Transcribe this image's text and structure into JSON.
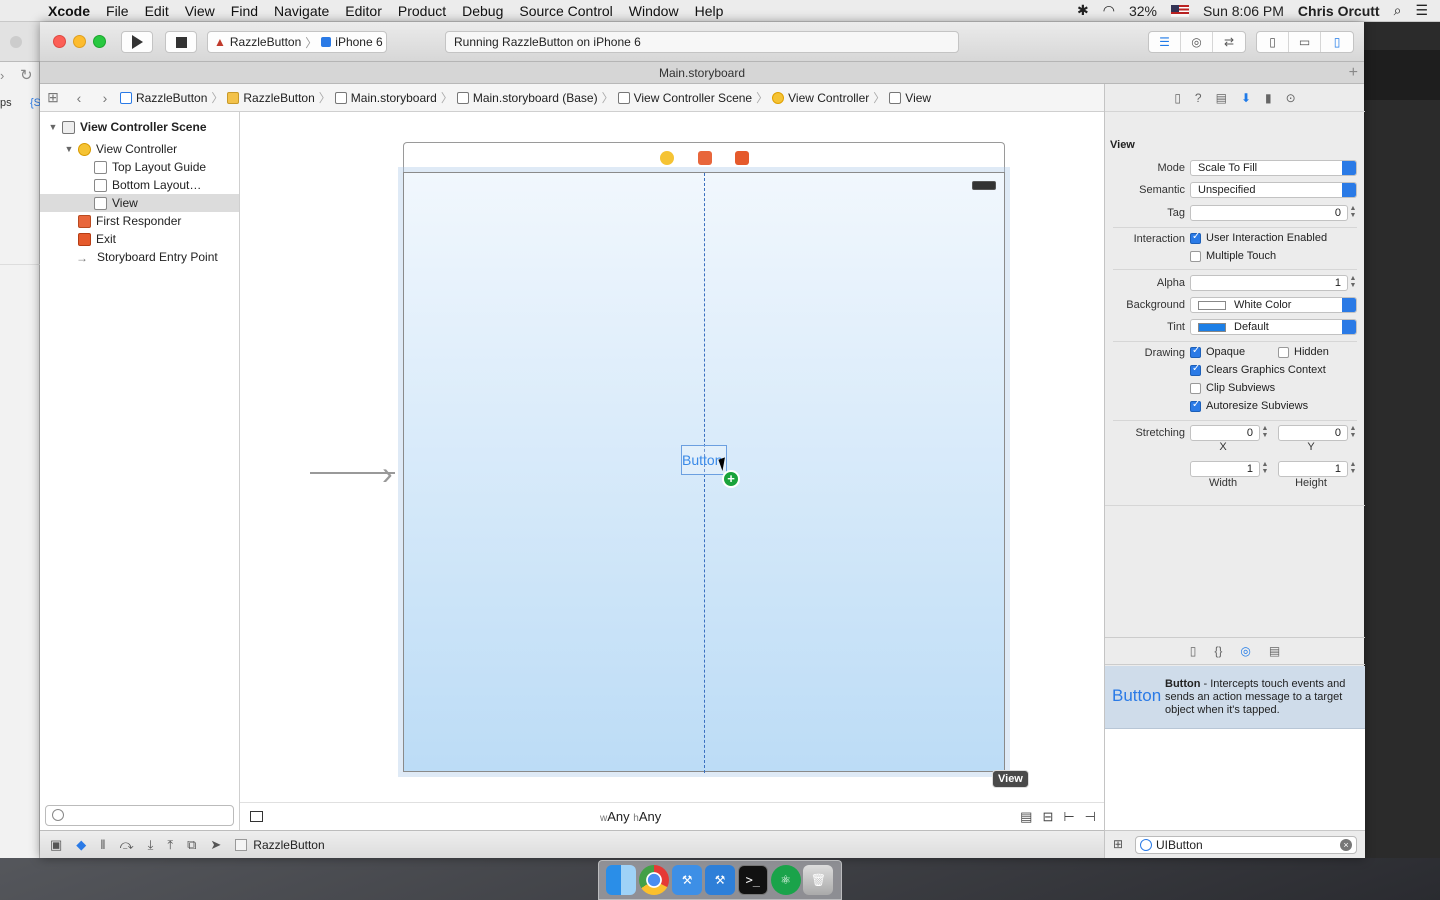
{
  "menubar": {
    "app": "Xcode",
    "items": [
      "File",
      "Edit",
      "View",
      "Find",
      "Navigate",
      "Editor",
      "Product",
      "Debug",
      "Source Control",
      "Window",
      "Help"
    ],
    "battery": "32%",
    "clock": "Sun 8:06 PM",
    "user": "Chris Orcutt"
  },
  "left_window": {
    "text1": "ps",
    "text2": "{S"
  },
  "toolbar": {
    "scheme_target": "RazzleButton",
    "scheme_device": "iPhone 6",
    "activity": "Running RazzleButton on iPhone 6"
  },
  "tab": {
    "title": "Main.storyboard"
  },
  "jumpbar": {
    "crumbs": [
      "RazzleButton",
      "RazzleButton",
      "Main.storyboard",
      "Main.storyboard (Base)",
      "View Controller Scene",
      "View Controller",
      "View"
    ]
  },
  "outline": {
    "scene": "View Controller Scene",
    "vc": "View Controller",
    "top_guide": "Top Layout Guide",
    "bottom_guide": "Bottom Layout…",
    "view": "View",
    "first_responder": "First Responder",
    "exit": "Exit",
    "entry": "Storyboard Entry Point"
  },
  "canvas": {
    "button_label": "Button",
    "tooltip": "View",
    "size_w_prefix": "w",
    "size_w": "Any",
    "size_h_prefix": "h",
    "size_h": "Any"
  },
  "debugbar": {
    "target": "RazzleButton"
  },
  "inspector": {
    "section": "View",
    "mode_label": "Mode",
    "mode_value": "Scale To Fill",
    "semantic_label": "Semantic",
    "semantic_value": "Unspecified",
    "tag_label": "Tag",
    "tag_value": "0",
    "interaction_label": "Interaction",
    "user_interaction": "User Interaction Enabled",
    "multiple_touch": "Multiple Touch",
    "alpha_label": "Alpha",
    "alpha_value": "1",
    "background_label": "Background",
    "background_value": "White Color",
    "tint_label": "Tint",
    "tint_value": "Default",
    "drawing_label": "Drawing",
    "opaque": "Opaque",
    "hidden": "Hidden",
    "clears": "Clears Graphics Context",
    "clip": "Clip Subviews",
    "autoresize": "Autoresize Subviews",
    "stretching_label": "Stretching",
    "stretch_x": "0",
    "stretch_y": "0",
    "x_label": "X",
    "y_label": "Y",
    "width_value": "1",
    "height_value": "1",
    "width_label": "Width",
    "height_label": "Height"
  },
  "library": {
    "item_big": "Button",
    "item_name": "Button",
    "item_desc": " - Intercepts touch events and sends an action message to a target object when it's tapped.",
    "search": "UIButton"
  },
  "colors": {
    "accent": "#2a7ae6",
    "install_green": "#1aa33b",
    "tint_swatch": "#1c7fe6"
  }
}
